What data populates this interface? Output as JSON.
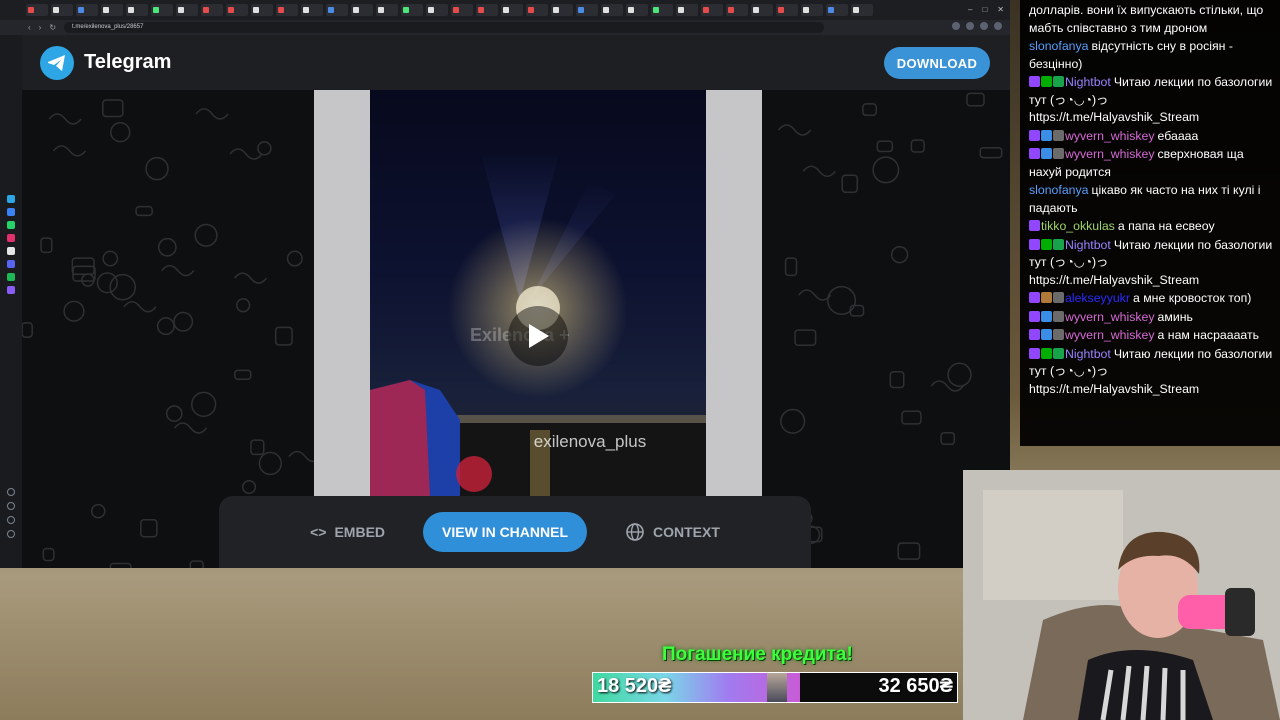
{
  "browser": {
    "url": "t.me/exilenova_plus/28657",
    "window_controls": [
      "–",
      "□",
      "✕"
    ],
    "nav": [
      "‹",
      "›",
      "↻"
    ]
  },
  "telegram": {
    "brand": "Telegram",
    "download_label": "DOWNLOAD",
    "watermark": "exilenova_plus",
    "logo_mark": "Exilenova +",
    "embed_label": "EMBED",
    "view_label": "VIEW IN CHANNEL",
    "context_label": "CONTEXT",
    "accent": "#2ea6e5"
  },
  "chat": {
    "messages": [
      {
        "user": "",
        "color": "#8a7cf0",
        "badges": [],
        "text": "долларів. вони їх випускають стільки, що мабть співставно з тим дроном"
      },
      {
        "user": "slonofanya",
        "color": "#5a9fff",
        "badges": [],
        "text": "відсутність сну в росіян - безцінно)"
      },
      {
        "user": "Nightbot",
        "color": "#9a82ff",
        "badges": [
          "#9146ff",
          "#00ad03",
          "#18a34a"
        ],
        "text": "Читаю лекции по базологии тут (っ◔◡◔)っ https://t.me/Halyavshik_Stream"
      },
      {
        "user": "wyvern_whiskey",
        "color": "#d66ad6",
        "badges": [
          "#9146ff",
          "#3a8ee6",
          "#6b6b6b"
        ],
        "text": "ебаааа"
      },
      {
        "user": "wyvern_whiskey",
        "color": "#d66ad6",
        "badges": [
          "#9146ff",
          "#3a8ee6",
          "#6b6b6b"
        ],
        "text": "сверхновая ща нахуй родится"
      },
      {
        "user": "slonofanya",
        "color": "#5a9fff",
        "badges": [],
        "text": "цікаво як часто на них ті кулі і падають"
      },
      {
        "user": "tikko_okkulas",
        "color": "#9ed36a",
        "badges": [
          "#9146ff"
        ],
        "text": "а папа на есвеоу"
      },
      {
        "user": "Nightbot",
        "color": "#9a82ff",
        "badges": [
          "#9146ff",
          "#00ad03",
          "#18a34a"
        ],
        "text": "Читаю лекции по базологии тут (っ◔◡◔)っ https://t.me/Halyavshik_Stream"
      },
      {
        "user": "alekseyyukr",
        "color": "#2a2aff",
        "badges": [
          "#9146ff",
          "#b07a3a",
          "#6b6b6b"
        ],
        "text": "а мне кровосток топ)"
      },
      {
        "user": "wyvern_whiskey",
        "color": "#d66ad6",
        "badges": [
          "#9146ff",
          "#3a8ee6",
          "#6b6b6b"
        ],
        "text": "аминь"
      },
      {
        "user": "wyvern_whiskey",
        "color": "#d66ad6",
        "badges": [
          "#9146ff",
          "#3a8ee6",
          "#6b6b6b"
        ],
        "text": "а нам насраааать"
      },
      {
        "user": "Nightbot",
        "color": "#9a82ff",
        "badges": [
          "#9146ff",
          "#00ad03",
          "#18a34a"
        ],
        "text": "Читаю лекции по базологии тут (っ◔◡◔)っ https://t.me/Halyavshik_Stream"
      }
    ]
  },
  "credit": {
    "title": "Погашение кредита!",
    "current": "18 520₴",
    "goal": "32 650₴",
    "progress": 0.57
  }
}
